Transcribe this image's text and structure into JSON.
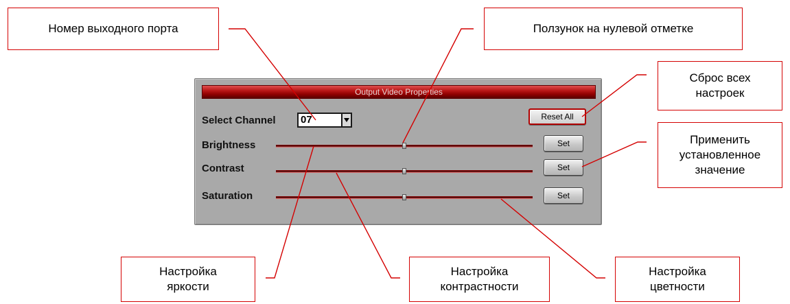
{
  "panel": {
    "title": "Output Video Properties",
    "select_channel_label": "Select Channel",
    "channel_value": "07",
    "reset_label": "Reset All",
    "rows": [
      {
        "label": "Brightness",
        "set_label": "Set",
        "level": 0.5
      },
      {
        "label": "Contrast",
        "set_label": "Set",
        "level": 0.5
      },
      {
        "label": "Saturation",
        "set_label": "Set",
        "level": 0.5
      }
    ]
  },
  "callouts": {
    "port_number": "Номер выходного порта",
    "slider_zero": "Ползунок на нулевой отметке",
    "reset_all": [
      "Сброс всех",
      "настроек"
    ],
    "apply_value": [
      "Применить",
      "установленное",
      "значение"
    ],
    "brightness": [
      "Настройка",
      "яркости"
    ],
    "contrast": [
      "Настройка",
      "контрастности"
    ],
    "saturation": [
      "Настройка",
      "цветности"
    ]
  },
  "colors": {
    "callout_border": "#d40000",
    "leader_line": "#d40000",
    "panel_bg": "#a9a9a9",
    "title_bar": "#8e0000"
  }
}
